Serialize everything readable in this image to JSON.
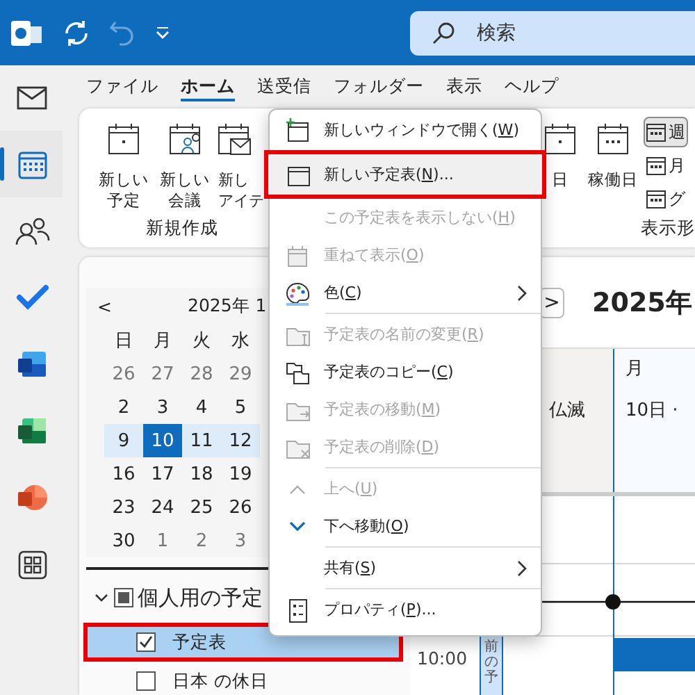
{
  "topbar": {
    "search": {
      "placeholder": "検索"
    }
  },
  "rail": [
    {
      "selected": false
    },
    {
      "selected": true
    },
    {
      "selected": false
    },
    {
      "selected": false
    },
    {
      "selected": false
    },
    {
      "selected": false
    },
    {
      "selected": false
    },
    {
      "selected": false
    }
  ],
  "menu_tabs": [
    {
      "label": "ファイル",
      "selected": false
    },
    {
      "label": "ホーム",
      "selected": true
    },
    {
      "label": "送受信",
      "selected": false
    },
    {
      "label": "フォルダー",
      "selected": false
    },
    {
      "label": "表示",
      "selected": false
    },
    {
      "label": "ヘルプ",
      "selected": false
    }
  ],
  "ribbon": {
    "groups": [
      {
        "label": "新規作成",
        "buttons": [
          {
            "kind": "large",
            "lines": [
              "新しい",
              "予定"
            ]
          },
          {
            "kind": "large",
            "lines": [
              "新しい",
              "会議"
            ]
          },
          {
            "kind": "large",
            "lines": [
              "新し",
              "アイテ"
            ]
          }
        ]
      },
      {
        "label": "表示形",
        "buttons": [
          {
            "kind": "large",
            "lines": [
              "日"
            ],
            "selected": false
          },
          {
            "kind": "large",
            "lines": [
              "稼働日"
            ],
            "selected": false
          },
          {
            "kind": "small",
            "lines": [
              "週"
            ],
            "selected": true
          },
          {
            "kind": "small",
            "lines": [
              "月"
            ],
            "selected": false
          },
          {
            "kind": "small",
            "lines": [
              "グ"
            ],
            "selected": false
          }
        ]
      }
    ]
  },
  "mini_calendar": {
    "prev": "<",
    "title": "2025年 1",
    "weekdays": [
      "日",
      "月",
      "火",
      "水"
    ],
    "weeks": [
      {
        "selected": false,
        "days": [
          {
            "day": "26",
            "other_month": true,
            "selected": false
          },
          {
            "day": "27",
            "other_month": true,
            "selected": false
          },
          {
            "day": "28",
            "other_month": true,
            "selected": false
          },
          {
            "day": "29",
            "other_month": true,
            "selected": false
          }
        ]
      },
      {
        "selected": false,
        "days": [
          {
            "day": "2",
            "other_month": false,
            "selected": false
          },
          {
            "day": "3",
            "other_month": false,
            "selected": false
          },
          {
            "day": "4",
            "other_month": false,
            "selected": false
          },
          {
            "day": "5",
            "other_month": false,
            "selected": false
          }
        ]
      },
      {
        "selected": true,
        "days": [
          {
            "day": "9",
            "other_month": false,
            "selected": false
          },
          {
            "day": "10",
            "other_month": false,
            "selected": true
          },
          {
            "day": "11",
            "other_month": false,
            "selected": false
          },
          {
            "day": "12",
            "other_month": false,
            "selected": false
          }
        ]
      },
      {
        "selected": false,
        "days": [
          {
            "day": "16",
            "other_month": false,
            "selected": false
          },
          {
            "day": "17",
            "other_month": false,
            "selected": false
          },
          {
            "day": "18",
            "other_month": false,
            "selected": false
          },
          {
            "day": "19",
            "other_month": false,
            "selected": false
          }
        ]
      },
      {
        "selected": false,
        "days": [
          {
            "day": "23",
            "other_month": false,
            "selected": false
          },
          {
            "day": "24",
            "other_month": false,
            "selected": false
          },
          {
            "day": "25",
            "other_month": false,
            "selected": false
          },
          {
            "day": "26",
            "other_month": false,
            "selected": false
          }
        ]
      },
      {
        "selected": false,
        "days": [
          {
            "day": "30",
            "other_month": false,
            "selected": false
          },
          {
            "day": "1",
            "other_month": true,
            "selected": false
          },
          {
            "day": "2",
            "other_month": true,
            "selected": false
          },
          {
            "day": "3",
            "other_month": true,
            "selected": false
          }
        ]
      }
    ]
  },
  "folders": {
    "group": {
      "label": "個人用の予定",
      "expanded": true
    },
    "items": [
      {
        "label": "予定表",
        "checked": true,
        "selected": true
      },
      {
        "label": "日本 の休日",
        "checked": false,
        "selected": false
      }
    ]
  },
  "day_view": {
    "next": ">",
    "title": "2025年",
    "columns": [
      {
        "allday": "仏滅",
        "selected": false
      },
      {
        "header": "月",
        "allday": "10日 ·",
        "selected": true
      }
    ],
    "time_label": "10:00",
    "strip": "前の予"
  },
  "context_menu": {
    "items": [
      {
        "kind": "item",
        "before": "新しいウィンドウで開く(",
        "key": "W",
        "after": ")",
        "disabled": false,
        "selected": false,
        "submenu": false
      },
      {
        "kind": "item",
        "before": "新しい予定表(",
        "key": "N",
        "after": ")...",
        "disabled": false,
        "selected": true,
        "submenu": false
      },
      {
        "kind": "item",
        "before": "この予定表を表示しない(",
        "key": "H",
        "after": ")",
        "disabled": true,
        "selected": false,
        "submenu": false
      },
      {
        "kind": "item",
        "before": "重ねて表示(",
        "key": "O",
        "after": ")",
        "disabled": true,
        "selected": false,
        "submenu": false
      },
      {
        "kind": "item",
        "before": "色(",
        "key": "C",
        "after": ")",
        "disabled": false,
        "selected": false,
        "submenu": true
      },
      {
        "kind": "separator"
      },
      {
        "kind": "item",
        "before": "予定表の名前の変更(",
        "key": "R",
        "after": ")",
        "disabled": true,
        "selected": false,
        "submenu": false
      },
      {
        "kind": "item",
        "before": "予定表のコピー(",
        "key": "C",
        "after": ")",
        "disabled": false,
        "selected": false,
        "submenu": false
      },
      {
        "kind": "item",
        "before": "予定表の移動(",
        "key": "M",
        "after": ")",
        "disabled": true,
        "selected": false,
        "submenu": false
      },
      {
        "kind": "item",
        "before": "予定表の削除(",
        "key": "D",
        "after": ")",
        "disabled": true,
        "selected": false,
        "submenu": false
      },
      {
        "kind": "separator"
      },
      {
        "kind": "item",
        "before": "上へ(",
        "key": "U",
        "after": ")",
        "disabled": true,
        "selected": false,
        "submenu": false
      },
      {
        "kind": "item",
        "before": "下へ移動(",
        "key": "O",
        "after": ")",
        "disabled": false,
        "selected": false,
        "submenu": false
      },
      {
        "kind": "separator"
      },
      {
        "kind": "item",
        "before": "共有(",
        "key": "S",
        "after": ")",
        "disabled": false,
        "selected": false,
        "submenu": true
      },
      {
        "kind": "separator"
      },
      {
        "kind": "item",
        "before": "プロパティ(",
        "key": "P",
        "after": ")...",
        "disabled": false,
        "selected": false,
        "submenu": false
      }
    ]
  }
}
